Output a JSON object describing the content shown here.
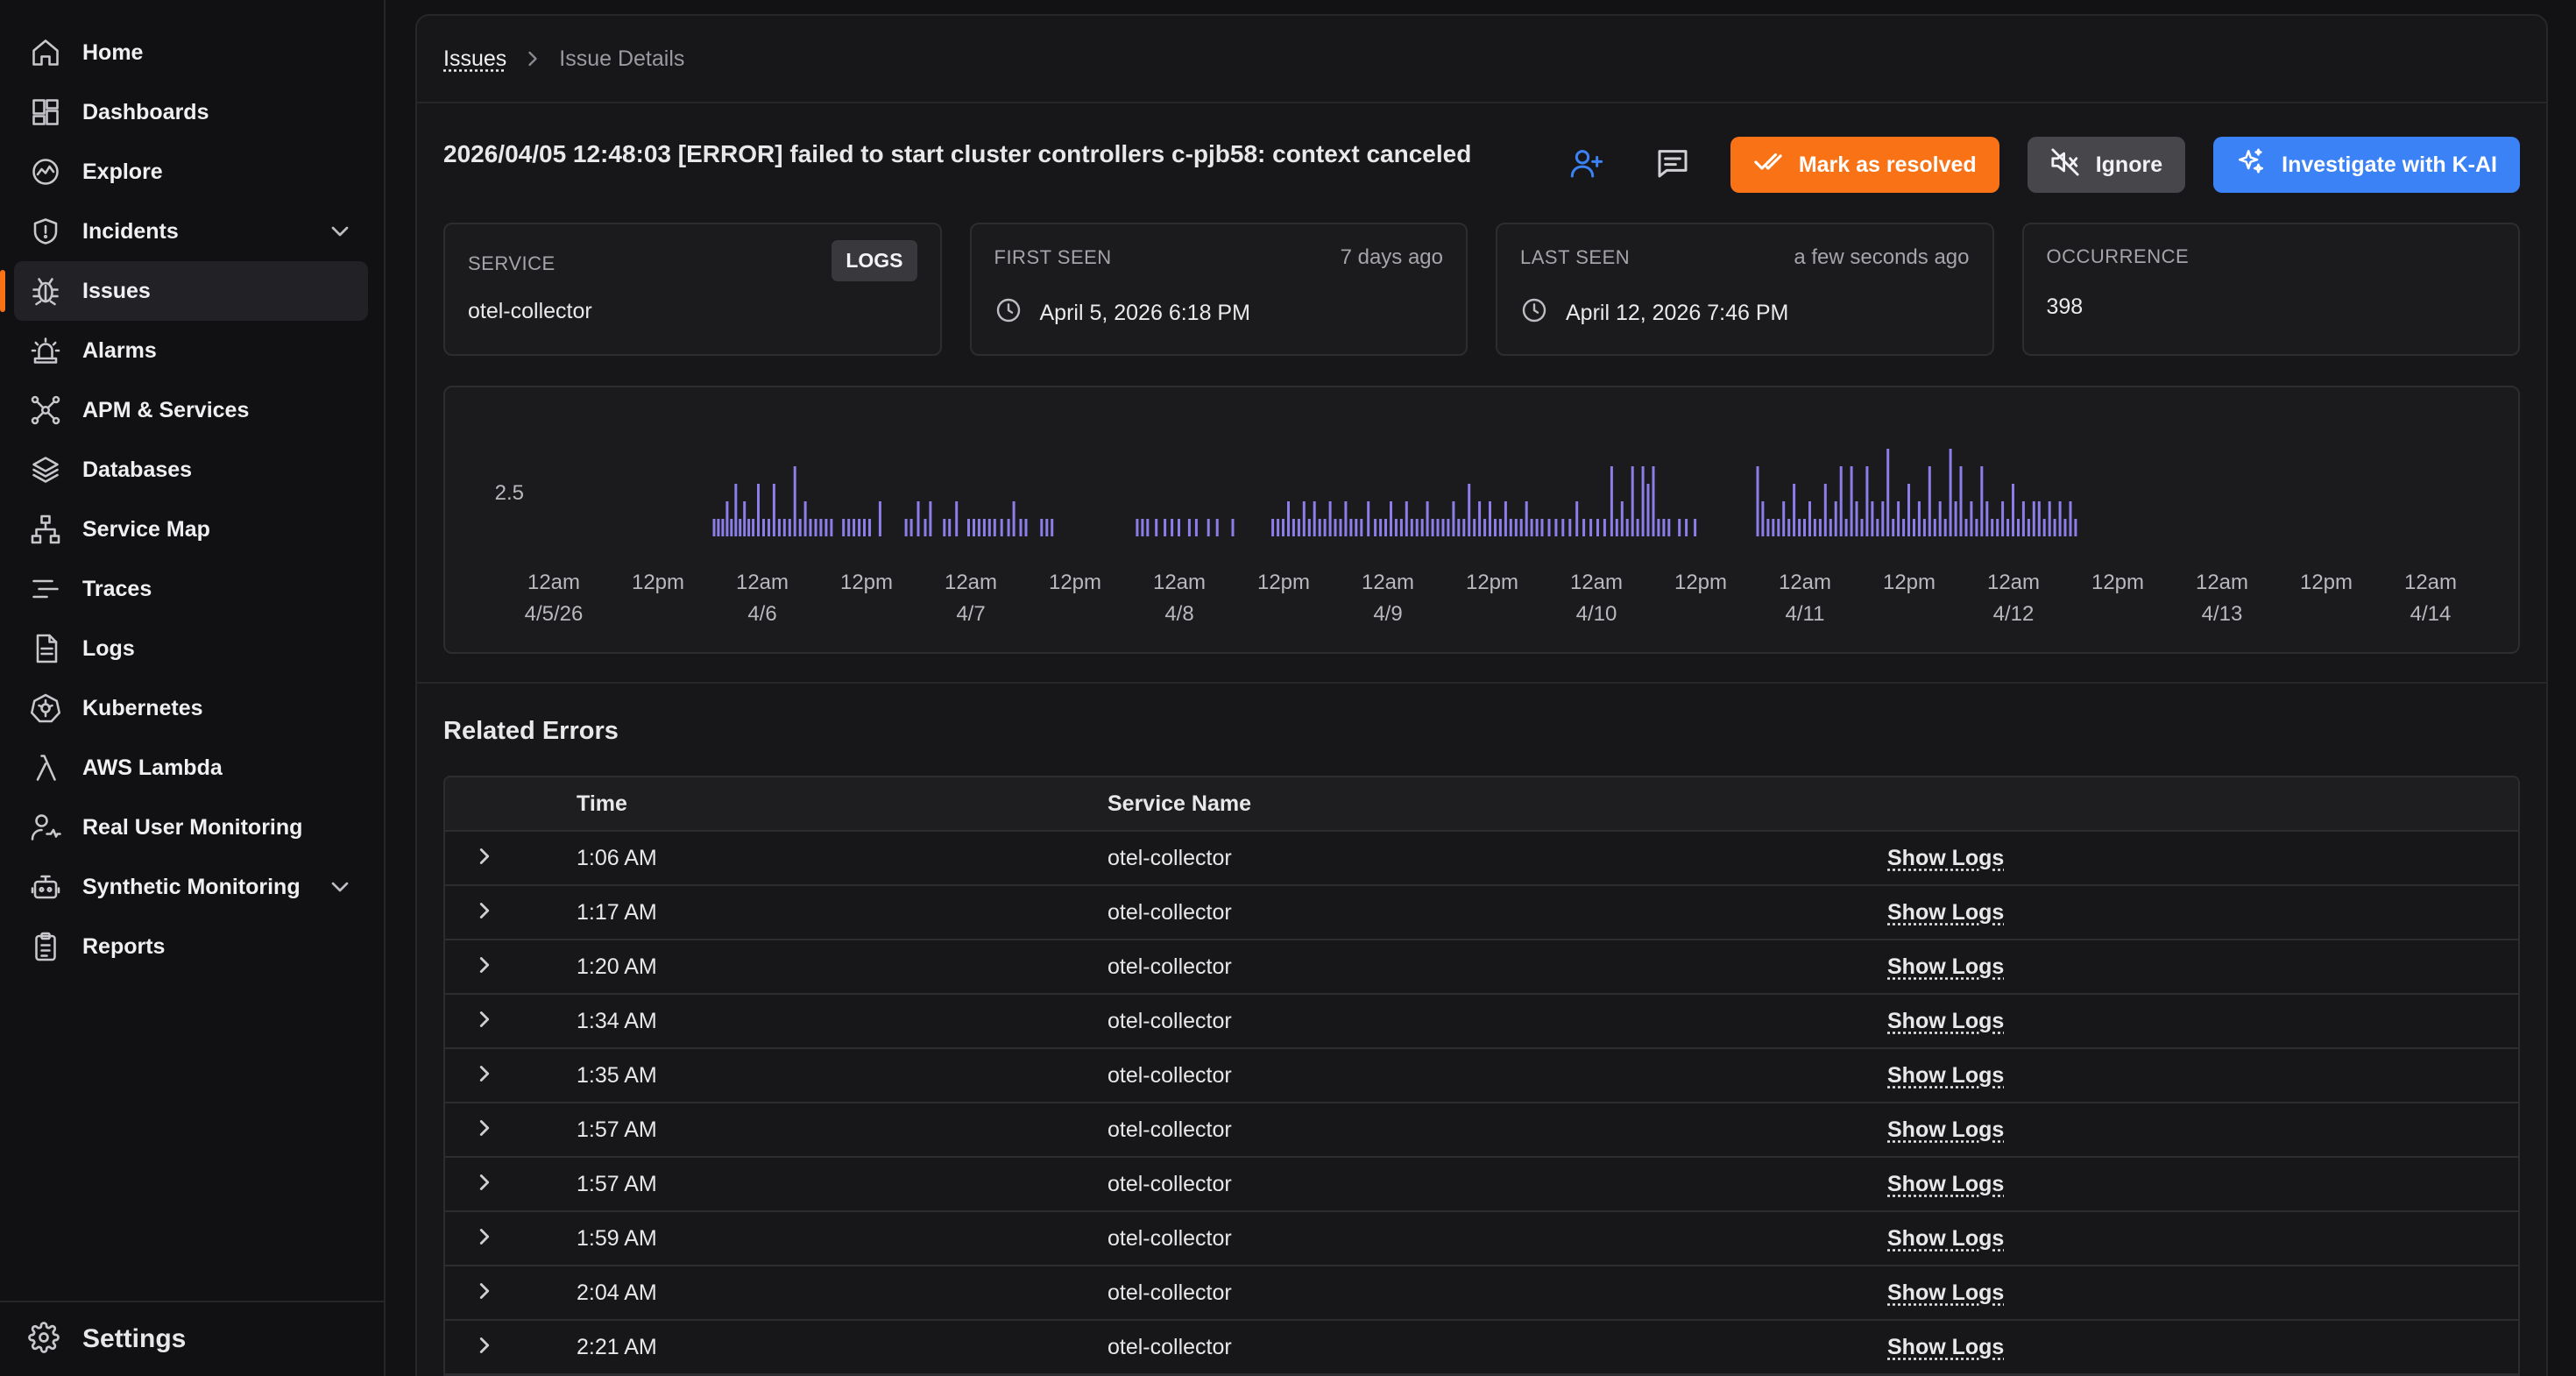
{
  "sidebar": {
    "items": [
      {
        "label": "Home",
        "icon": "home-icon"
      },
      {
        "label": "Dashboards",
        "icon": "dashboard-grid-icon"
      },
      {
        "label": "Explore",
        "icon": "explore-chart-icon"
      },
      {
        "label": "Incidents",
        "icon": "shield-alert-icon",
        "expandable": true
      },
      {
        "label": "Issues",
        "icon": "bug-icon",
        "active": true
      },
      {
        "label": "Alarms",
        "icon": "siren-icon"
      },
      {
        "label": "APM & Services",
        "icon": "network-nodes-icon"
      },
      {
        "label": "Databases",
        "icon": "layers-icon"
      },
      {
        "label": "Service Map",
        "icon": "sitemap-icon"
      },
      {
        "label": "Traces",
        "icon": "traces-lines-icon"
      },
      {
        "label": "Logs",
        "icon": "file-text-icon"
      },
      {
        "label": "Kubernetes",
        "icon": "kubernetes-icon"
      },
      {
        "label": "AWS Lambda",
        "icon": "lambda-icon"
      },
      {
        "label": "Real User Monitoring",
        "icon": "user-monitor-icon"
      },
      {
        "label": "Synthetic Monitoring",
        "icon": "robot-icon",
        "expandable": true
      },
      {
        "label": "Reports",
        "icon": "clipboard-icon"
      }
    ],
    "footer": {
      "label": "Settings",
      "icon": "gear-icon"
    }
  },
  "breadcrumb": {
    "root": "Issues",
    "current": "Issue Details"
  },
  "issue": {
    "title": "2026/04/05 12:48:03 [ERROR] failed to start cluster controllers c-pjb58: context canceled"
  },
  "actions": {
    "resolve_label": "Mark as resolved",
    "ignore_label": "Ignore",
    "investigate_label": "Investigate with K-AI"
  },
  "cards": {
    "service": {
      "label": "SERVICE",
      "tag": "LOGS",
      "value": "otel-collector"
    },
    "first_seen": {
      "label": "FIRST SEEN",
      "relative": "7 days ago",
      "value": "April 5, 2026 6:18 PM"
    },
    "last_seen": {
      "label": "LAST SEEN",
      "relative": "a few seconds ago",
      "value": "April 12, 2026 7:46 PM"
    },
    "occurrence": {
      "label": "OCCURRENCE",
      "value": "398"
    }
  },
  "chart_data": {
    "type": "bar",
    "title": "",
    "y_ticks": [
      "2.5"
    ],
    "ylim": [
      0,
      5
    ],
    "bar_color": "#8b7ee8",
    "x_ticks": [
      {
        "line1": "12am",
        "line2": "4/5/26"
      },
      {
        "line1": "12pm",
        "line2": ""
      },
      {
        "line1": "12am",
        "line2": "4/6"
      },
      {
        "line1": "12pm",
        "line2": ""
      },
      {
        "line1": "12am",
        "line2": "4/7"
      },
      {
        "line1": "12pm",
        "line2": ""
      },
      {
        "line1": "12am",
        "line2": "4/8"
      },
      {
        "line1": "12pm",
        "line2": ""
      },
      {
        "line1": "12am",
        "line2": "4/9"
      },
      {
        "line1": "12pm",
        "line2": ""
      },
      {
        "line1": "12am",
        "line2": "4/10"
      },
      {
        "line1": "12pm",
        "line2": ""
      },
      {
        "line1": "12am",
        "line2": "4/11"
      },
      {
        "line1": "12pm",
        "line2": ""
      },
      {
        "line1": "12am",
        "line2": "4/12"
      },
      {
        "line1": "12pm",
        "line2": ""
      },
      {
        "line1": "12am",
        "line2": "4/13"
      },
      {
        "line1": "12pm",
        "line2": ""
      },
      {
        "line1": "12am",
        "line2": "4/14"
      }
    ],
    "x_range_hours": [
      0,
      216
    ],
    "bars": [
      {
        "x": 18.3,
        "y": 1
      },
      {
        "x": 18.8,
        "y": 1
      },
      {
        "x": 19.3,
        "y": 1
      },
      {
        "x": 19.8,
        "y": 2
      },
      {
        "x": 20.3,
        "y": 1
      },
      {
        "x": 20.8,
        "y": 3
      },
      {
        "x": 21.3,
        "y": 1
      },
      {
        "x": 21.8,
        "y": 2
      },
      {
        "x": 22.3,
        "y": 1
      },
      {
        "x": 22.8,
        "y": 1
      },
      {
        "x": 23.4,
        "y": 3
      },
      {
        "x": 24.0,
        "y": 1
      },
      {
        "x": 24.6,
        "y": 1
      },
      {
        "x": 25.2,
        "y": 3
      },
      {
        "x": 25.8,
        "y": 1
      },
      {
        "x": 26.4,
        "y": 1
      },
      {
        "x": 27.0,
        "y": 1
      },
      {
        "x": 27.6,
        "y": 4
      },
      {
        "x": 28.2,
        "y": 1
      },
      {
        "x": 28.8,
        "y": 2
      },
      {
        "x": 29.4,
        "y": 1
      },
      {
        "x": 30.0,
        "y": 1
      },
      {
        "x": 30.6,
        "y": 1
      },
      {
        "x": 31.2,
        "y": 1
      },
      {
        "x": 31.8,
        "y": 1
      },
      {
        "x": 33.2,
        "y": 1
      },
      {
        "x": 33.8,
        "y": 1
      },
      {
        "x": 34.4,
        "y": 1
      },
      {
        "x": 35.0,
        "y": 1
      },
      {
        "x": 35.6,
        "y": 1
      },
      {
        "x": 36.2,
        "y": 1
      },
      {
        "x": 37.4,
        "y": 2
      },
      {
        "x": 40.4,
        "y": 1
      },
      {
        "x": 41.0,
        "y": 1
      },
      {
        "x": 41.8,
        "y": 2
      },
      {
        "x": 42.6,
        "y": 1
      },
      {
        "x": 43.2,
        "y": 2
      },
      {
        "x": 44.8,
        "y": 1
      },
      {
        "x": 45.4,
        "y": 1
      },
      {
        "x": 46.2,
        "y": 2
      },
      {
        "x": 47.6,
        "y": 1
      },
      {
        "x": 48.2,
        "y": 1
      },
      {
        "x": 48.8,
        "y": 1
      },
      {
        "x": 49.4,
        "y": 1
      },
      {
        "x": 50.0,
        "y": 1
      },
      {
        "x": 50.6,
        "y": 1
      },
      {
        "x": 51.4,
        "y": 1
      },
      {
        "x": 52.2,
        "y": 1
      },
      {
        "x": 52.8,
        "y": 2
      },
      {
        "x": 53.6,
        "y": 1
      },
      {
        "x": 54.2,
        "y": 1
      },
      {
        "x": 56.0,
        "y": 1
      },
      {
        "x": 56.6,
        "y": 1
      },
      {
        "x": 57.2,
        "y": 1
      },
      {
        "x": 67.0,
        "y": 1
      },
      {
        "x": 67.6,
        "y": 1
      },
      {
        "x": 68.2,
        "y": 1
      },
      {
        "x": 69.2,
        "y": 1
      },
      {
        "x": 70.2,
        "y": 1
      },
      {
        "x": 71.0,
        "y": 1
      },
      {
        "x": 71.8,
        "y": 1
      },
      {
        "x": 73.0,
        "y": 1
      },
      {
        "x": 73.8,
        "y": 1
      },
      {
        "x": 75.2,
        "y": 1
      },
      {
        "x": 76.2,
        "y": 1
      },
      {
        "x": 78.0,
        "y": 1
      },
      {
        "x": 82.6,
        "y": 1
      },
      {
        "x": 83.2,
        "y": 1
      },
      {
        "x": 83.8,
        "y": 1
      },
      {
        "x": 84.4,
        "y": 2
      },
      {
        "x": 85.0,
        "y": 1
      },
      {
        "x": 85.6,
        "y": 1
      },
      {
        "x": 86.2,
        "y": 2
      },
      {
        "x": 86.8,
        "y": 1
      },
      {
        "x": 87.4,
        "y": 2
      },
      {
        "x": 88.0,
        "y": 1
      },
      {
        "x": 88.6,
        "y": 1
      },
      {
        "x": 89.2,
        "y": 2
      },
      {
        "x": 89.8,
        "y": 1
      },
      {
        "x": 90.4,
        "y": 1
      },
      {
        "x": 91.0,
        "y": 2
      },
      {
        "x": 91.6,
        "y": 1
      },
      {
        "x": 92.2,
        "y": 1
      },
      {
        "x": 92.8,
        "y": 1
      },
      {
        "x": 93.6,
        "y": 2
      },
      {
        "x": 94.4,
        "y": 1
      },
      {
        "x": 95.0,
        "y": 1
      },
      {
        "x": 95.6,
        "y": 1
      },
      {
        "x": 96.2,
        "y": 2
      },
      {
        "x": 96.8,
        "y": 1
      },
      {
        "x": 97.4,
        "y": 1
      },
      {
        "x": 98.0,
        "y": 2
      },
      {
        "x": 98.6,
        "y": 1
      },
      {
        "x": 99.2,
        "y": 1
      },
      {
        "x": 99.8,
        "y": 1
      },
      {
        "x": 100.4,
        "y": 2
      },
      {
        "x": 101.0,
        "y": 1
      },
      {
        "x": 101.6,
        "y": 1
      },
      {
        "x": 102.2,
        "y": 1
      },
      {
        "x": 102.8,
        "y": 1
      },
      {
        "x": 103.4,
        "y": 2
      },
      {
        "x": 104.0,
        "y": 1
      },
      {
        "x": 104.6,
        "y": 1
      },
      {
        "x": 105.2,
        "y": 3
      },
      {
        "x": 105.8,
        "y": 1
      },
      {
        "x": 106.4,
        "y": 2
      },
      {
        "x": 107.0,
        "y": 1
      },
      {
        "x": 107.6,
        "y": 2
      },
      {
        "x": 108.2,
        "y": 1
      },
      {
        "x": 108.8,
        "y": 1
      },
      {
        "x": 109.4,
        "y": 2
      },
      {
        "x": 110.0,
        "y": 1
      },
      {
        "x": 110.6,
        "y": 1
      },
      {
        "x": 111.2,
        "y": 1
      },
      {
        "x": 111.8,
        "y": 2
      },
      {
        "x": 112.4,
        "y": 1
      },
      {
        "x": 113.0,
        "y": 1
      },
      {
        "x": 113.6,
        "y": 1
      },
      {
        "x": 114.4,
        "y": 1
      },
      {
        "x": 115.2,
        "y": 1
      },
      {
        "x": 116.0,
        "y": 1
      },
      {
        "x": 116.8,
        "y": 1
      },
      {
        "x": 117.6,
        "y": 2
      },
      {
        "x": 118.4,
        "y": 1
      },
      {
        "x": 119.2,
        "y": 1
      },
      {
        "x": 120.0,
        "y": 1
      },
      {
        "x": 120.8,
        "y": 1
      },
      {
        "x": 121.6,
        "y": 4
      },
      {
        "x": 122.2,
        "y": 1
      },
      {
        "x": 122.8,
        "y": 2
      },
      {
        "x": 123.4,
        "y": 1
      },
      {
        "x": 124.0,
        "y": 4
      },
      {
        "x": 124.6,
        "y": 1
      },
      {
        "x": 125.2,
        "y": 4
      },
      {
        "x": 125.8,
        "y": 3
      },
      {
        "x": 126.4,
        "y": 4
      },
      {
        "x": 127.0,
        "y": 1
      },
      {
        "x": 127.6,
        "y": 1
      },
      {
        "x": 128.2,
        "y": 1
      },
      {
        "x": 129.4,
        "y": 1
      },
      {
        "x": 130.2,
        "y": 1
      },
      {
        "x": 131.2,
        "y": 1
      },
      {
        "x": 138.4,
        "y": 4
      },
      {
        "x": 139.0,
        "y": 2
      },
      {
        "x": 139.6,
        "y": 1
      },
      {
        "x": 140.2,
        "y": 1
      },
      {
        "x": 140.8,
        "y": 1
      },
      {
        "x": 141.4,
        "y": 2
      },
      {
        "x": 142.0,
        "y": 1
      },
      {
        "x": 142.6,
        "y": 3
      },
      {
        "x": 143.2,
        "y": 1
      },
      {
        "x": 143.8,
        "y": 1
      },
      {
        "x": 144.4,
        "y": 2
      },
      {
        "x": 145.0,
        "y": 1
      },
      {
        "x": 145.6,
        "y": 1
      },
      {
        "x": 146.2,
        "y": 3
      },
      {
        "x": 146.8,
        "y": 1
      },
      {
        "x": 147.4,
        "y": 2
      },
      {
        "x": 148.0,
        "y": 4
      },
      {
        "x": 148.6,
        "y": 1
      },
      {
        "x": 149.2,
        "y": 4
      },
      {
        "x": 149.8,
        "y": 2
      },
      {
        "x": 150.4,
        "y": 1
      },
      {
        "x": 151.0,
        "y": 4
      },
      {
        "x": 151.6,
        "y": 2
      },
      {
        "x": 152.2,
        "y": 1
      },
      {
        "x": 152.8,
        "y": 2
      },
      {
        "x": 153.4,
        "y": 5
      },
      {
        "x": 154.0,
        "y": 1
      },
      {
        "x": 154.6,
        "y": 2
      },
      {
        "x": 155.2,
        "y": 1
      },
      {
        "x": 155.8,
        "y": 3
      },
      {
        "x": 156.4,
        "y": 1
      },
      {
        "x": 157.0,
        "y": 2
      },
      {
        "x": 157.6,
        "y": 1
      },
      {
        "x": 158.2,
        "y": 4
      },
      {
        "x": 158.8,
        "y": 1
      },
      {
        "x": 159.4,
        "y": 2
      },
      {
        "x": 160.0,
        "y": 1
      },
      {
        "x": 160.6,
        "y": 5
      },
      {
        "x": 161.2,
        "y": 2
      },
      {
        "x": 161.8,
        "y": 4
      },
      {
        "x": 162.4,
        "y": 1
      },
      {
        "x": 163.0,
        "y": 2
      },
      {
        "x": 163.6,
        "y": 1
      },
      {
        "x": 164.2,
        "y": 4
      },
      {
        "x": 164.8,
        "y": 2
      },
      {
        "x": 165.4,
        "y": 1
      },
      {
        "x": 166.0,
        "y": 1
      },
      {
        "x": 166.6,
        "y": 2
      },
      {
        "x": 167.2,
        "y": 1
      },
      {
        "x": 167.8,
        "y": 3
      },
      {
        "x": 168.4,
        "y": 1
      },
      {
        "x": 169.0,
        "y": 2
      },
      {
        "x": 169.6,
        "y": 1
      },
      {
        "x": 170.2,
        "y": 2
      },
      {
        "x": 170.8,
        "y": 2
      },
      {
        "x": 171.4,
        "y": 1
      },
      {
        "x": 172.0,
        "y": 2
      },
      {
        "x": 172.6,
        "y": 1
      },
      {
        "x": 173.2,
        "y": 2
      },
      {
        "x": 173.8,
        "y": 1
      },
      {
        "x": 174.4,
        "y": 2
      },
      {
        "x": 175.0,
        "y": 1
      }
    ]
  },
  "related": {
    "title": "Related Errors",
    "columns": {
      "time": "Time",
      "service": "Service Name"
    },
    "action_label": "Show Logs",
    "rows": [
      {
        "time": "1:06 AM",
        "service": "otel-collector"
      },
      {
        "time": "1:17 AM",
        "service": "otel-collector"
      },
      {
        "time": "1:20 AM",
        "service": "otel-collector"
      },
      {
        "time": "1:34 AM",
        "service": "otel-collector"
      },
      {
        "time": "1:35 AM",
        "service": "otel-collector"
      },
      {
        "time": "1:57 AM",
        "service": "otel-collector"
      },
      {
        "time": "1:57 AM",
        "service": "otel-collector"
      },
      {
        "time": "1:59 AM",
        "service": "otel-collector"
      },
      {
        "time": "2:04 AM",
        "service": "otel-collector"
      },
      {
        "time": "2:21 AM",
        "service": "otel-collector"
      }
    ]
  },
  "colors": {
    "accent": "#f97316",
    "primary_blue": "#3b82f6",
    "chart_bar": "#8b7ee8"
  }
}
